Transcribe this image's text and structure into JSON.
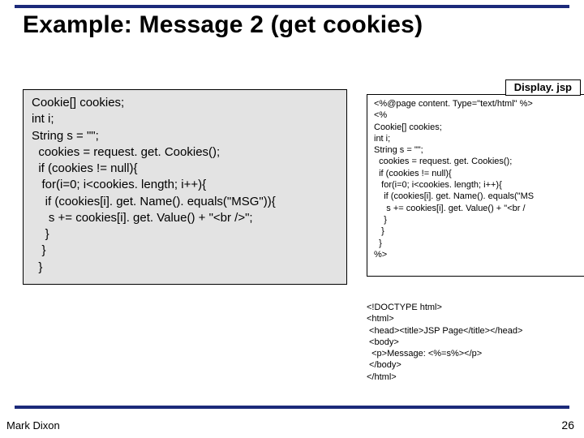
{
  "title": "Example: Message 2 (get cookies)",
  "left_code": "Cookie[] cookies;\nint i;\nString s = \"\";\n  cookies = request. get. Cookies();\n  if (cookies != null){\n   for(i=0; i<cookies. length; i++){\n    if (cookies[i]. get. Name(). equals(\"MSG\")){\n     s += cookies[i]. get. Value() + \"<br />\";\n    }\n   }\n  }",
  "file_label": "Display. jsp",
  "right_code": "<%@page content. Type=\"text/html\" %>\n<%\nCookie[] cookies;\nint i;\nString s = \"\";\n  cookies = request. get. Cookies();\n  if (cookies != null){\n   for(i=0; i<cookies. length; i++){\n    if (cookies[i]. get. Name(). equals(\"MS\n     s += cookies[i]. get. Value() + \"<br /\n    }\n   }\n  }\n%>",
  "right_html": "<!DOCTYPE html>\n<html>\n <head><title>JSP Page</title></head>\n <body>\n  <p>Message: <%=s%></p>\n </body>\n</html>",
  "footer_author": "Mark Dixon",
  "slide_number": "26"
}
